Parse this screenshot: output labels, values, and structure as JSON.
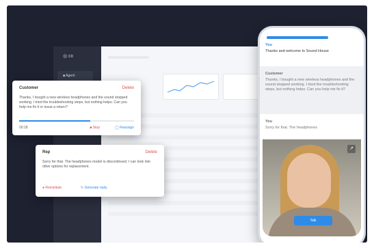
{
  "dashboard": {
    "logo": "◎ cx",
    "nav_item": "■ Agent"
  },
  "customer_card": {
    "speaker": "Customer",
    "delete_label": "Delete",
    "message": "Thanks, I bought a new wireless headphones and the sound stopped working. I tried the troubleshooting steps, but nothing helps. Can you help me fix it or issue a return?",
    "time": "00:28",
    "stop_label": "Stop",
    "alt_label": "Reassign"
  },
  "rep_card": {
    "speaker": "Rep",
    "delete_label": "Delete",
    "message": "Sorry for that. The headphones model is discontinued. I can look into other options for replacement.",
    "action1": "Reinstitute",
    "action2": "Generate reply"
  },
  "phone": {
    "header_label": "You",
    "header_text": "Thanks and welcome to Sound House",
    "msg1_label": "Customer",
    "msg1_text": "Thanks, I bought a new wireless headphones and the sound stopped working. I tried the troubleshooting steps, but nothing helps. Can you help me fix it?",
    "msg2_label": "You",
    "msg2_text": "Sorry for that. The headphones",
    "video_button": "Talk",
    "expand_icon": "↗"
  },
  "colors": {
    "accent": "#2e8be8",
    "danger": "#d9534f",
    "background": "#1e2130"
  }
}
